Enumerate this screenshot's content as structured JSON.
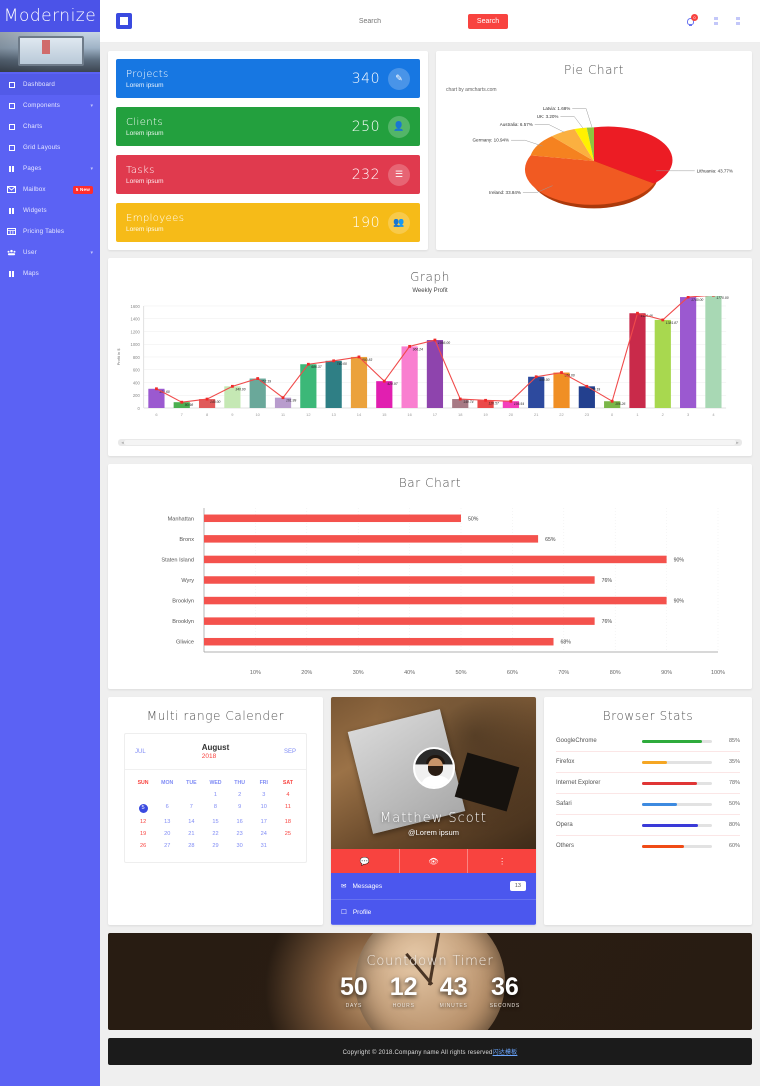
{
  "sidebar": {
    "brand": "Modernize",
    "items": [
      {
        "label": "Dashboard",
        "icon": "gauge-icon",
        "active": true,
        "caret": false,
        "badge": null
      },
      {
        "label": "Components",
        "icon": "grid-icon",
        "active": false,
        "caret": true,
        "badge": null
      },
      {
        "label": "Charts",
        "icon": "chart-icon",
        "active": false,
        "caret": false,
        "badge": null
      },
      {
        "label": "Grid Layouts",
        "icon": "layout-icon",
        "active": false,
        "caret": false,
        "badge": null
      },
      {
        "label": "Pages",
        "icon": "pages-icon",
        "active": false,
        "caret": true,
        "badge": null
      },
      {
        "label": "Mailbox",
        "icon": "envelope-icon",
        "active": false,
        "caret": false,
        "badge": "5 New"
      },
      {
        "label": "Widgets",
        "icon": "widgets-icon",
        "active": false,
        "caret": false,
        "badge": null
      },
      {
        "label": "Pricing Tables",
        "icon": "table-icon",
        "active": false,
        "caret": false,
        "badge": null
      },
      {
        "label": "User",
        "icon": "users-icon",
        "active": false,
        "caret": true,
        "badge": null
      },
      {
        "label": "Maps",
        "icon": "map-icon",
        "active": false,
        "caret": false,
        "badge": null
      }
    ]
  },
  "topbar": {
    "menu_toggle": "hamburger-icon",
    "search_placeholder": "Search",
    "search_value": "",
    "search_button": "Search",
    "notification_count": "0"
  },
  "info_cards": [
    {
      "title": "Projects",
      "subtitle": "Lorem ipsum",
      "value": "340",
      "color": "#1777e2",
      "icon": "edit-icon"
    },
    {
      "title": "Clients",
      "subtitle": "Lorem ipsum",
      "value": "250",
      "color": "#23a03e",
      "icon": "user-icon"
    },
    {
      "title": "Tasks",
      "subtitle": "Lorem ipsum",
      "value": "232",
      "color": "#e03a4e",
      "icon": "list-icon"
    },
    {
      "title": "Employees",
      "subtitle": "Lorem ipsum",
      "value": "190",
      "color": "#f6bb18",
      "icon": "people-icon"
    }
  ],
  "pie": {
    "title": "Pie Chart",
    "credit": "chart by amcharts.com"
  },
  "graph": {
    "title": "Graph"
  },
  "bar": {
    "title": "Bar Chart"
  },
  "calendar": {
    "title": "Multi range Calender",
    "prev": "JUL",
    "month": "August",
    "year": "2018",
    "next": "SEP",
    "dow": [
      "SUN",
      "MON",
      "TUE",
      "WED",
      "THU",
      "FRI",
      "SAT"
    ],
    "weeks": [
      [
        "",
        "",
        "",
        "1",
        "2",
        "3",
        "4"
      ],
      [
        "5",
        "6",
        "7",
        "8",
        "9",
        "10",
        "11"
      ],
      [
        "12",
        "13",
        "14",
        "15",
        "16",
        "17",
        "18"
      ],
      [
        "19",
        "20",
        "21",
        "22",
        "23",
        "24",
        "25"
      ],
      [
        "26",
        "27",
        "28",
        "29",
        "30",
        "31",
        ""
      ]
    ],
    "selected": "5"
  },
  "profile": {
    "name": "Matthew Scott",
    "handle": "@Lorem ipsum",
    "actions": [
      "chat-icon",
      "eye-icon",
      "menu-icon"
    ],
    "links": [
      {
        "label": "Messages",
        "icon": "envelope-icon",
        "badge": "13"
      },
      {
        "label": "Profile",
        "icon": "user-icon",
        "badge": null
      }
    ]
  },
  "browser_stats": {
    "title": "Browser Stats"
  },
  "countdown": {
    "title": "Countdown Timer",
    "units": [
      {
        "value": "50",
        "label": "DAYS"
      },
      {
        "value": "12",
        "label": "HOURS"
      },
      {
        "value": "43",
        "label": "MINUTES"
      },
      {
        "value": "36",
        "label": "SECONDS"
      }
    ]
  },
  "footer": {
    "text": "Copyright © 2018.Company name All rights reserved",
    "link": "闪达模板"
  },
  "chart_data": [
    {
      "type": "pie",
      "title": "Pie Chart",
      "annotation": "chart by amcharts.com",
      "labels": [
        "Lithuania",
        "Ireland",
        "Germany",
        "Australia",
        "UK",
        "Latvia"
      ],
      "values": [
        43.77,
        33.84,
        10.94,
        6.57,
        3.2,
        1.68
      ],
      "value_suffix": "%",
      "colors": [
        "#ec1c24",
        "#f15a22",
        "#f58220",
        "#fbb040",
        "#fff200",
        "#8dc63f"
      ],
      "legend": "labels-with-leader-lines"
    },
    {
      "type": "bar",
      "title": "Graph",
      "subtitle": "Weekly Profit",
      "xlabel": "",
      "ylabel": "Profit in $",
      "ylim": [
        0,
        1600
      ],
      "yticks": [
        0,
        200,
        400,
        600,
        800,
        1000,
        1200,
        1400,
        1600
      ],
      "grid": true,
      "overlay_line": true,
      "categories": [
        "6",
        "7",
        "8",
        "9",
        "10",
        "11",
        "12",
        "13",
        "14",
        "15",
        "16",
        "17",
        "18",
        "19",
        "20",
        "21",
        "22",
        "23",
        "0",
        "1",
        "2",
        "3",
        "4"
      ],
      "values": [
        301.6,
        90.98,
        140.0,
        340.0,
        462.19,
        161.99,
        686.37,
        740.0,
        800.83,
        420.97,
        966.24,
        1066.0,
        140.74,
        120.57,
        106.54,
        490.0,
        556.0,
        340.19,
        106.26,
        1486.48,
        1381.87,
        1740.0,
        1770.0
      ],
      "bar_colors": [
        "#9b59d0",
        "#4caf50",
        "#e05a5a",
        "#c5e8b4",
        "#6aa89a",
        "#b89ccd",
        "#3cb878",
        "#2f7f85",
        "#eba23c",
        "#e11fb0",
        "#f97fd0",
        "#8e44ad",
        "#a77a85",
        "#ea4848",
        "#f43fbb",
        "#2d4a9e",
        "#f08f25",
        "#23408e",
        "#7ab648",
        "#c92a4a",
        "#a8d84f",
        "#9b59d0",
        "#a8d8b4"
      ],
      "scrollbar": true
    },
    {
      "type": "bar",
      "orientation": "horizontal",
      "title": "Bar Chart",
      "xlabel": "",
      "ylabel": "",
      "xlim": [
        0,
        100
      ],
      "xticks": [
        "10%",
        "20%",
        "30%",
        "40%",
        "50%",
        "60%",
        "70%",
        "80%",
        "90%",
        "100%"
      ],
      "categories": [
        "Manhattan",
        "Bronx",
        "Staten Island",
        "Wyry",
        "Brooklyn",
        "Brooklyn",
        "Gliwice"
      ],
      "values": [
        50,
        65,
        90,
        76,
        90,
        76,
        68
      ],
      "value_labels": [
        "50%",
        "65%",
        "90%",
        "76%",
        "90%",
        "76%",
        "68%"
      ],
      "bar_color": "#f4524d",
      "grid": true
    },
    {
      "type": "bar",
      "orientation": "horizontal",
      "title": "Browser Stats",
      "categories": [
        "GoogleChrome",
        "Firefox",
        "Internet Explorer",
        "Safari",
        "Opera",
        "Others"
      ],
      "values": [
        85,
        35,
        78,
        50,
        80,
        60
      ],
      "value_labels": [
        "85%",
        "35%",
        "78%",
        "50%",
        "80%",
        "60%"
      ],
      "colors": [
        "#2eab3c",
        "#f5a623",
        "#e03535",
        "#3d8ae0",
        "#3a3ad8",
        "#f04b16"
      ],
      "xlim": [
        0,
        100
      ]
    }
  ]
}
